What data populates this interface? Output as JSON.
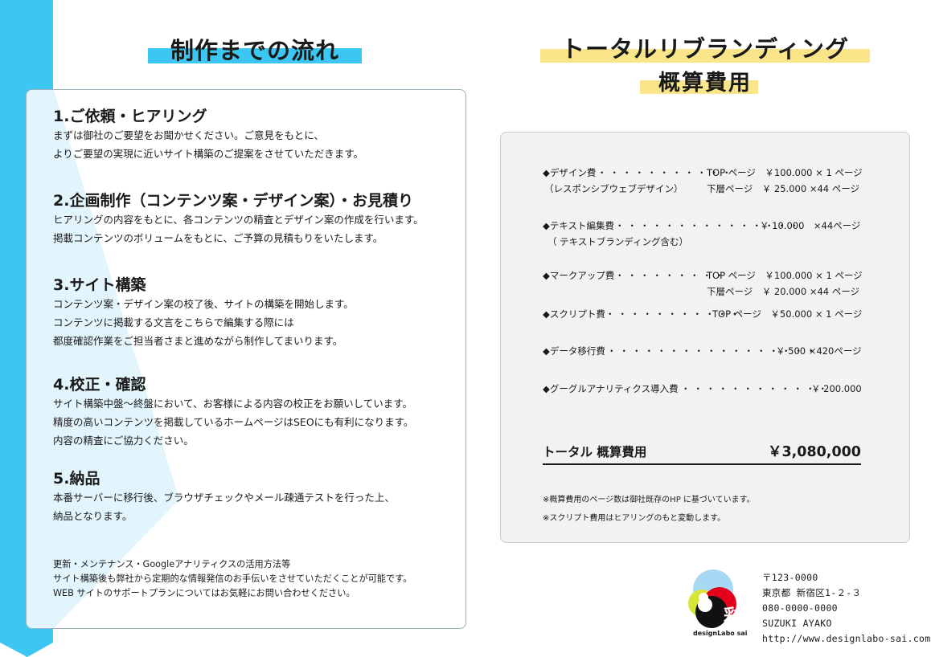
{
  "left": {
    "title": "制作までの流れ",
    "steps": [
      {
        "heading": "1.ご依頼・ヒアリング",
        "lines": [
          "まずは御社のご要望をお聞かせください。ご意見をもとに、",
          "よりご要望の実現に近いサイト構築のご提案をさせていただきます。"
        ]
      },
      {
        "heading": "2.企画制作（コンテンツ案・デザイン案）・お見積り",
        "lines": [
          "ヒアリングの内容をもとに、各コンテンツの精査とデザイン案の作成を行います。",
          "掲載コンテンツのボリュームをもとに、ご予算の見積もりをいたします。"
        ]
      },
      {
        "heading": "3.サイト構築",
        "lines": [
          "コンテンツ案・デザイン案の校了後、サイトの構築を開始します。",
          "コンテンツに掲載する文言をこちらで編集する際には",
          "都度確認作業をご担当者さまと進めながら制作してまいります。"
        ]
      },
      {
        "heading": "4.校正・確認",
        "lines": [
          "サイト構築中盤～終盤において、お客様による内容の校正をお願いしています。",
          "精度の高いコンテンツを掲載しているホームページはSEOにも有利になります。",
          "内容の精査にご協力ください。"
        ]
      },
      {
        "heading": "5.納品",
        "lines": [
          "本番サーバーに移行後、ブラウザチェックやメール疎通テストを行った上、",
          "納品となります。"
        ]
      }
    ],
    "note": [
      "更新・メンテナンス・Googleアナリティクスの活用方法等",
      "サイト構築後も弊社から定期的な情報発信のお手伝いをさせていただくことが可能です。",
      "WEB サイトのサポートプランについてはお気軽にお問い合わせください。"
    ]
  },
  "right": {
    "title_line1": "トータルリブランディング",
    "title_line2": "概算費用",
    "items": [
      {
        "name": "◆デザイン費",
        "sub": "（レスポンシブウェブデザイン）",
        "prices": [
          "TOP ページ　￥100.000 × 1 ページ",
          "下層ページ　￥ 25.000 ×44 ページ"
        ]
      },
      {
        "name": "◆テキスト編集費",
        "sub": "（ テキストブランディング含む）",
        "prices": [
          "￥ 10.000　×44ページ"
        ]
      },
      {
        "name": "◆マークアップ費",
        "sub": "",
        "prices": [
          "TOP ページ　￥100.000 × 1 ページ",
          "下層ページ　￥ 20.000 ×44 ページ"
        ]
      },
      {
        "name": "◆スクリプト費",
        "sub": "",
        "prices": [
          "TOP ページ　￥50.000 × 1 ページ"
        ]
      },
      {
        "name": "◆データ移行費",
        "sub": "",
        "prices": [
          "￥ 500 ×420ページ"
        ]
      },
      {
        "name": "◆グーグルアナリティクス導入費",
        "sub": "",
        "prices": [
          "￥ 200.000"
        ]
      }
    ],
    "total_label": "トータル 概算費用",
    "total_amount": "￥3,080,000",
    "footnotes": [
      "※概算費用のページ数は御社既存のHP に基づいています。",
      "※スクリプト費用はヒアリングのもと変動します。"
    ]
  },
  "contact": {
    "logo_text": "designLabo sai",
    "logo_kanji": "彩",
    "lines": [
      "〒123-0000",
      "東京都 新宿区1-２-３",
      "080-0000-0000",
      "SUZUKI AYAKO",
      "http://www.designlabo-sai.com"
    ]
  },
  "colors": {
    "accent_blue": "#3cc6f2",
    "accent_yellow": "#fbe58a",
    "panel_gray": "#f2f2f2"
  }
}
